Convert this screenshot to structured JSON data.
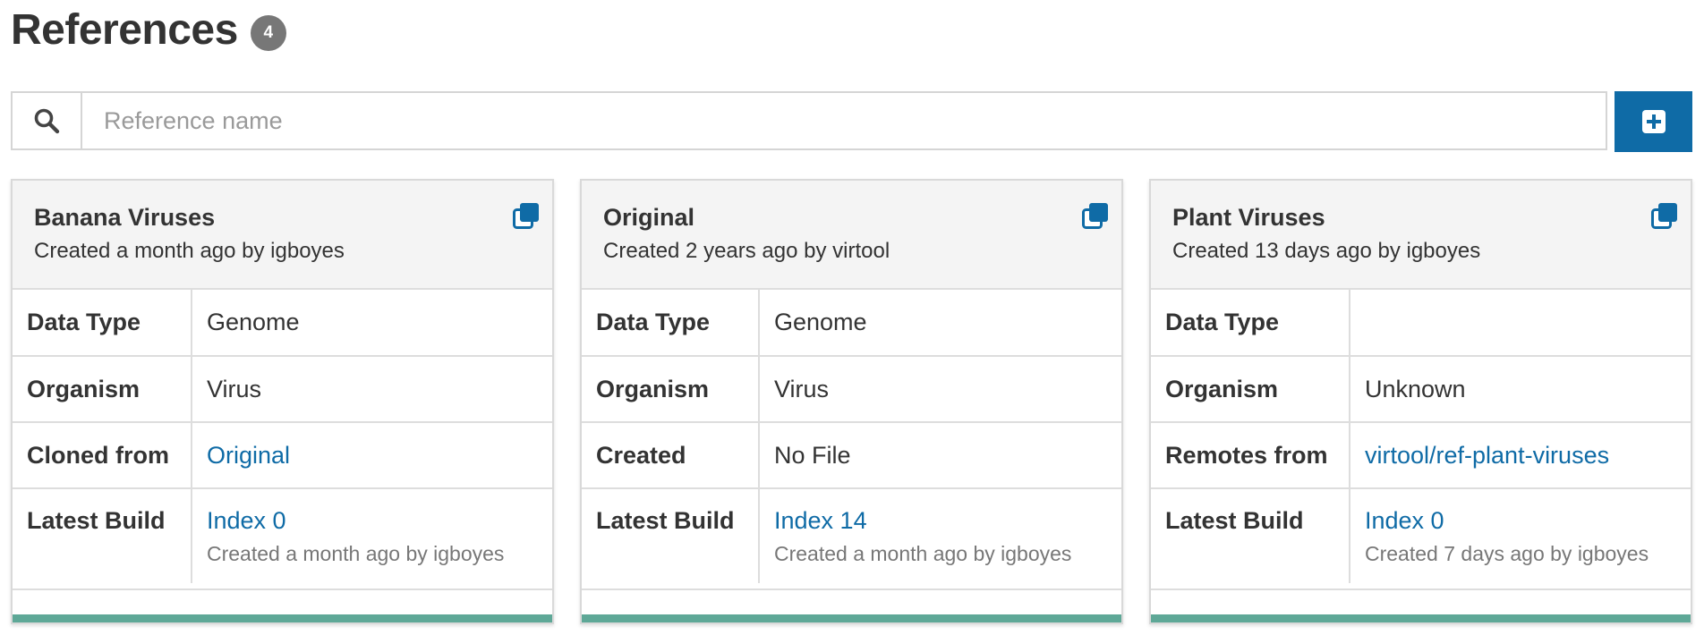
{
  "header": {
    "title": "References",
    "count": "4"
  },
  "search": {
    "placeholder": "Reference name",
    "value": ""
  },
  "colors": {
    "accent": "#0f6ba6",
    "progress": "#5ea897",
    "badge": "#777777"
  },
  "cards": [
    {
      "name": "Banana Viruses",
      "created": "Created a month ago by igboyes",
      "rows": [
        {
          "key": "Data Type",
          "value": "Genome"
        },
        {
          "key": "Organism",
          "value": "Virus"
        },
        {
          "key": "Cloned from",
          "value": "Original"
        }
      ],
      "build": {
        "key": "Latest Build",
        "value": "Index 0",
        "sub": "Created a month ago by igboyes"
      },
      "progress": 1.0
    },
    {
      "name": "Original",
      "created": "Created 2 years ago by virtool",
      "rows": [
        {
          "key": "Data Type",
          "value": "Genome"
        },
        {
          "key": "Organism",
          "value": "Virus"
        },
        {
          "key": "Created",
          "value": "No File"
        }
      ],
      "build": {
        "key": "Latest Build",
        "value": "Index 14",
        "sub": "Created a month ago by igboyes"
      },
      "progress": 1.0
    },
    {
      "name": "Plant Viruses",
      "created": "Created 13 days ago by igboyes",
      "rows": [
        {
          "key": "Data Type",
          "value": ""
        },
        {
          "key": "Organism",
          "value": "Unknown"
        },
        {
          "key": "Remotes from",
          "value": "virtool/ref-plant-viruses"
        }
      ],
      "build": {
        "key": "Latest Build",
        "value": "Index 0",
        "sub": "Created 7 days ago by igboyes"
      },
      "progress": 1.0
    }
  ]
}
